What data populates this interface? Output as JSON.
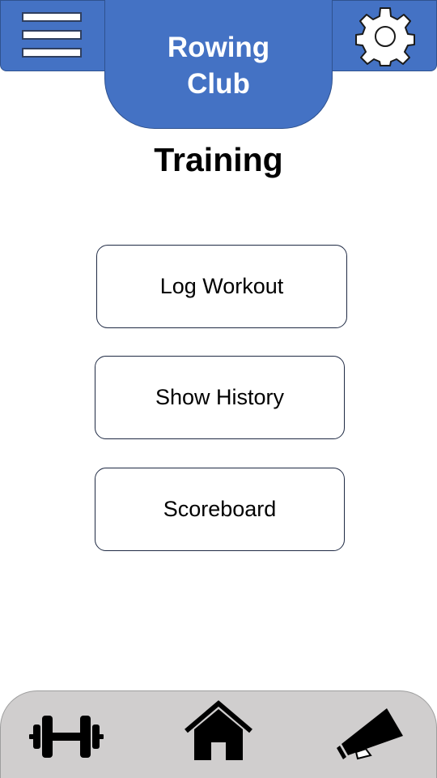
{
  "header": {
    "title": "Rowing\nClub",
    "menu_icon": "hamburger-menu-icon",
    "settings_icon": "gear-icon"
  },
  "page": {
    "title": "Training"
  },
  "menu": {
    "items": [
      {
        "label": "Log Workout"
      },
      {
        "label": "Show History"
      },
      {
        "label": "Scoreboard"
      }
    ]
  },
  "bottom_nav": {
    "items": [
      {
        "icon": "dumbbell-icon"
      },
      {
        "icon": "home-icon"
      },
      {
        "icon": "megaphone-icon"
      }
    ]
  },
  "colors": {
    "header_blue": "#4472C4",
    "header_border": "#2F528F",
    "bottom_bar": "#D0CECE",
    "text": "#000000",
    "header_text": "#ffffff"
  }
}
